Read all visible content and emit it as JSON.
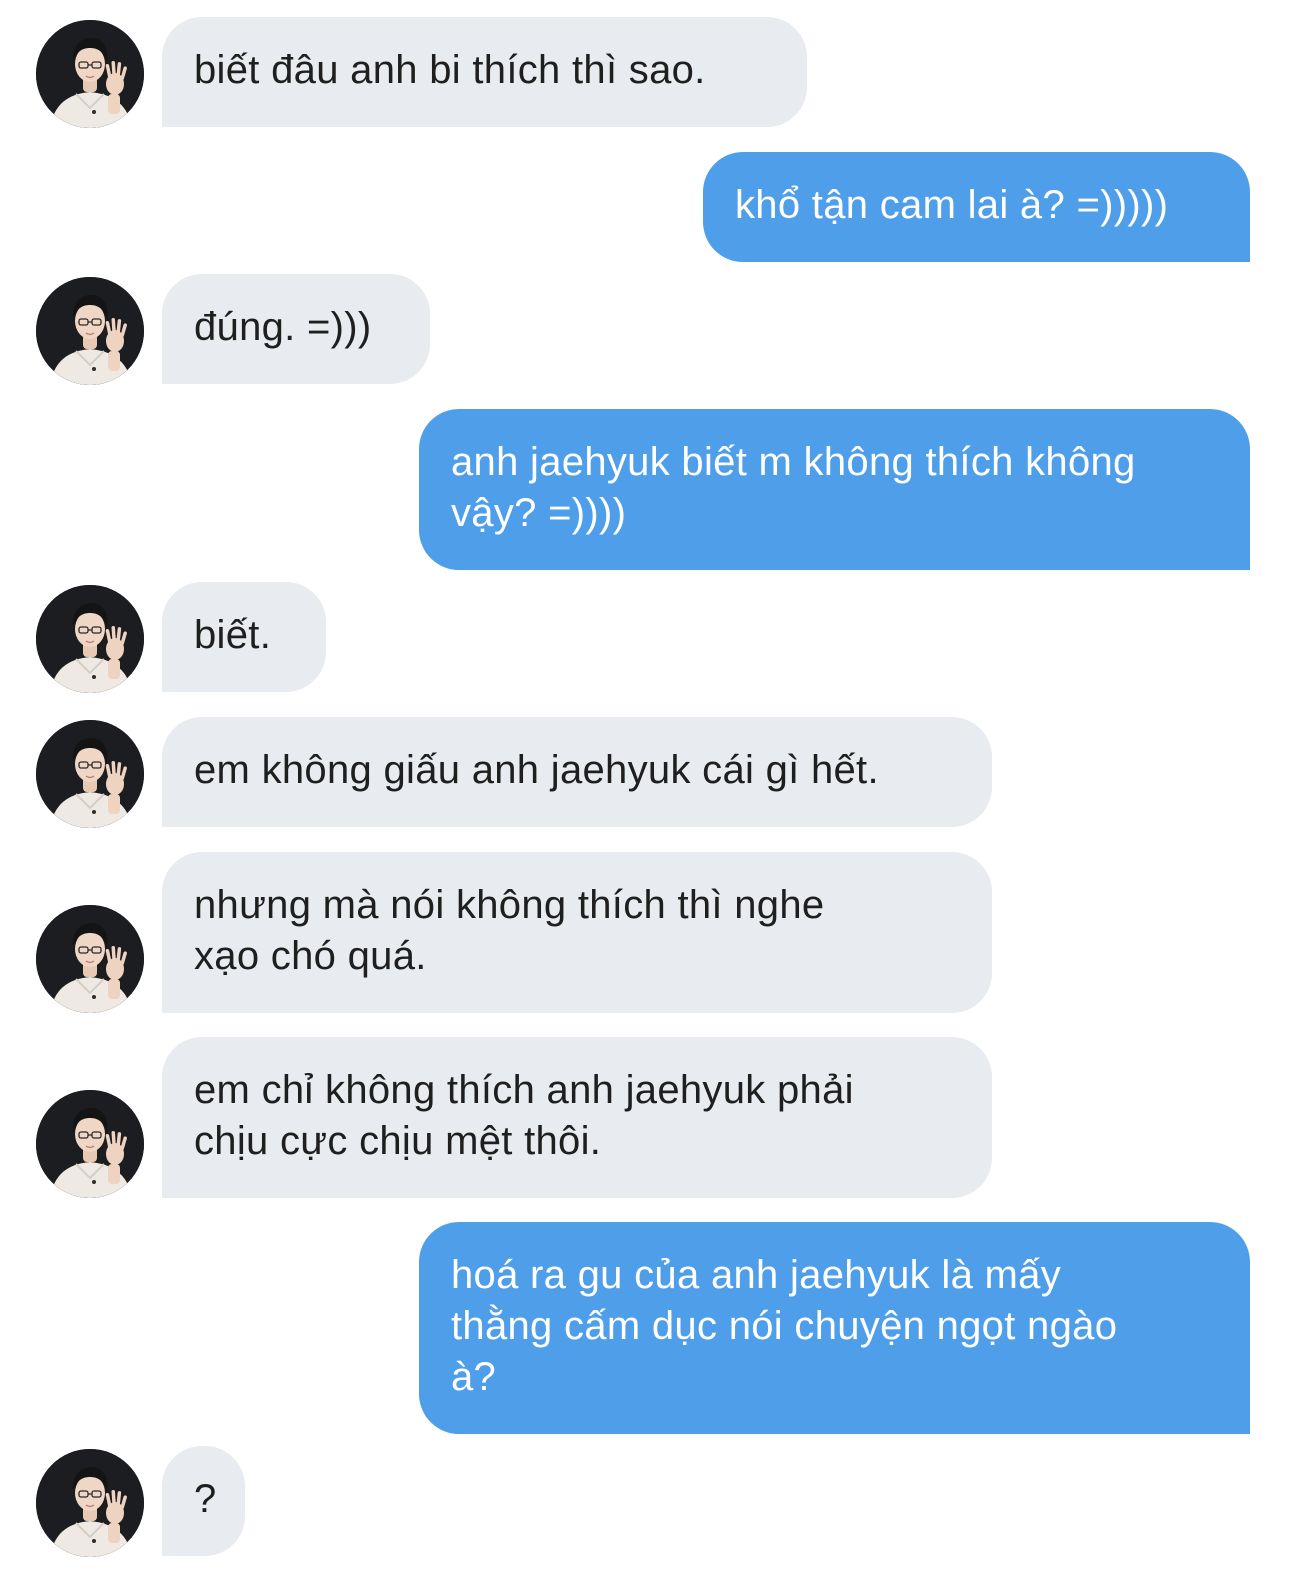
{
  "conversation": {
    "messages": [
      {
        "from": "other",
        "lines": [
          "biết đâu anh bi thích thì sao."
        ]
      },
      {
        "from": "me",
        "lines": [
          "khổ tận cam lai à? =)))))"
        ]
      },
      {
        "from": "other",
        "lines": [
          "đúng. =)))"
        ]
      },
      {
        "from": "me",
        "lines": [
          "anh jaehyuk biết m không thích không",
          "vậy? =))))"
        ]
      },
      {
        "from": "other",
        "lines": [
          "biết."
        ]
      },
      {
        "from": "other",
        "lines": [
          "em không giấu anh jaehyuk cái gì hết."
        ]
      },
      {
        "from": "other",
        "lines": [
          "nhưng mà nói không thích thì nghe",
          "xạo chó quá."
        ]
      },
      {
        "from": "other",
        "lines": [
          "em chỉ không thích anh jaehyuk phải",
          "chịu cực chịu mệt thôi."
        ]
      },
      {
        "from": "me",
        "lines": [
          "hoá ra gu của anh jaehyuk là mấy",
          "thằng cấm dục nói chuyện ngọt ngào",
          "à?"
        ]
      },
      {
        "from": "other",
        "lines": [
          "?"
        ]
      }
    ]
  },
  "colors": {
    "incoming_bubble": "#e8ebef",
    "incoming_text": "#1f1f1f",
    "outgoing_bubble": "#4e9eea",
    "outgoing_text": "#ffffff",
    "background": "#ffffff"
  },
  "icons": {
    "avatar": "profile-photo-avatar"
  }
}
